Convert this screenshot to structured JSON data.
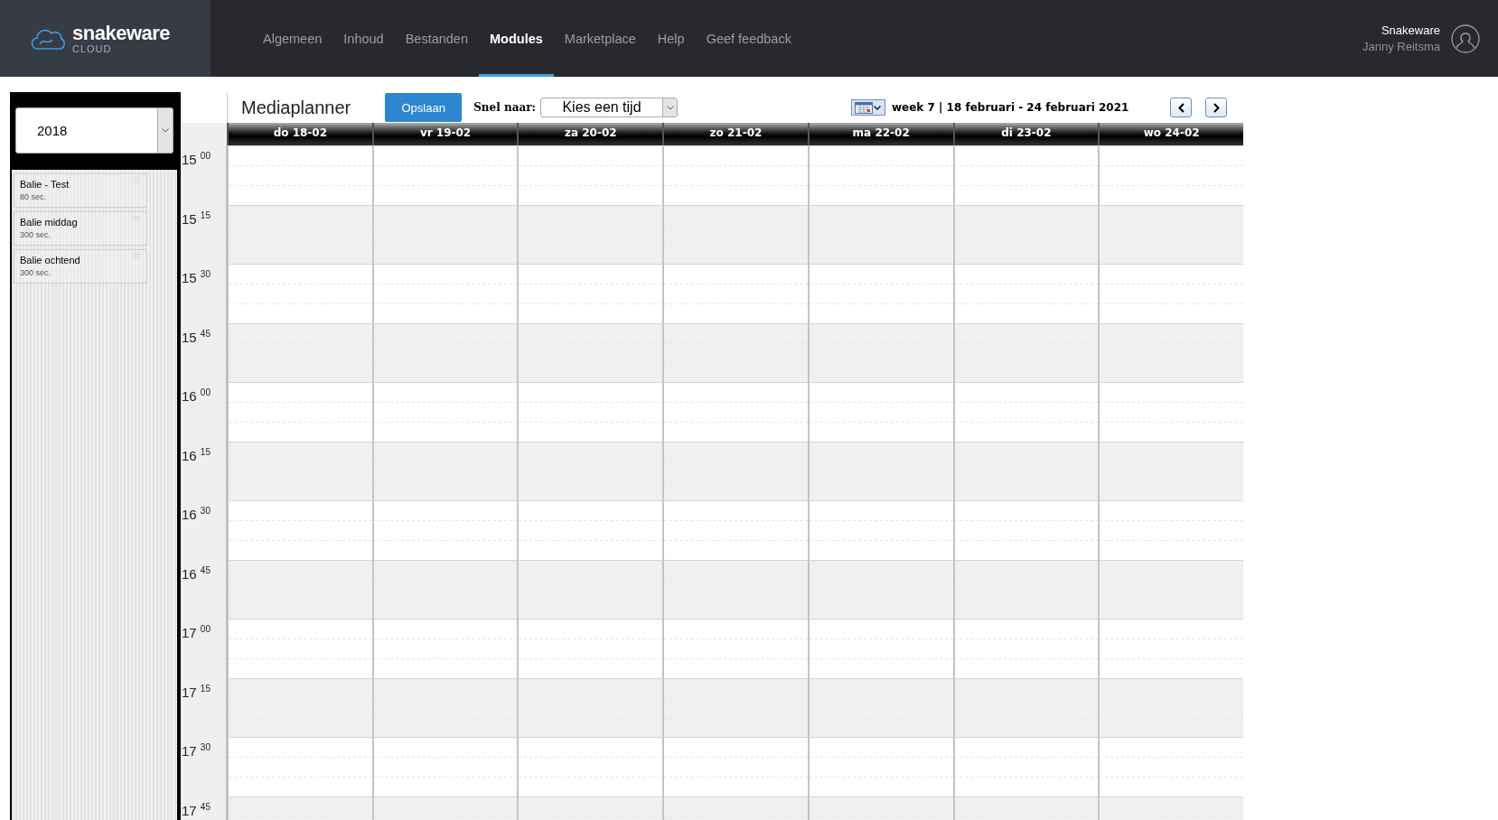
{
  "header": {
    "logo": {
      "name": "snakeware",
      "subtitle": "CLOUD"
    },
    "nav": [
      {
        "label": "Algemeen",
        "selected": false
      },
      {
        "label": "Inhoud",
        "selected": false
      },
      {
        "label": "Bestanden",
        "selected": false
      },
      {
        "label": "Modules",
        "selected": true
      },
      {
        "label": "Marketplace",
        "selected": false
      },
      {
        "label": "Help",
        "selected": false
      },
      {
        "label": "Geef feedback",
        "selected": false
      }
    ],
    "user": {
      "organization": "Snakeware",
      "name": "Janny Reitsma"
    }
  },
  "sidebar": {
    "year_select": {
      "value": "2018"
    },
    "items": [
      {
        "title": "Balie - Test",
        "duration": "80 sec."
      },
      {
        "title": "Balie middag",
        "duration": "300 sec."
      },
      {
        "title": "Balie ochtend",
        "duration": "300 sec."
      }
    ]
  },
  "planner": {
    "title": "Mediaplanner",
    "save_button": "Opslaan",
    "jump_label": "Snel naar:",
    "jump_select": {
      "value": "Kies een tijd"
    },
    "week_label": "week 7 | 18 februari - 24 februari 2021",
    "days": [
      "do 18-02",
      "vr 19-02",
      "za 20-02",
      "zo 21-02",
      "ma 22-02",
      "di 23-02",
      "wo 24-02"
    ],
    "times": [
      "15 $^{00}$",
      "15 $^{15}$",
      "15 $^{30}$",
      "15 $^{45}$",
      "16 $^{00}$",
      "16 $^{15}$",
      "16 $^{30}$",
      "16 $^{45}$",
      "17 $^{00}$",
      "17 $^{15}$",
      "17 $^{30}$",
      "17 $^{45}$"
    ]
  }
}
